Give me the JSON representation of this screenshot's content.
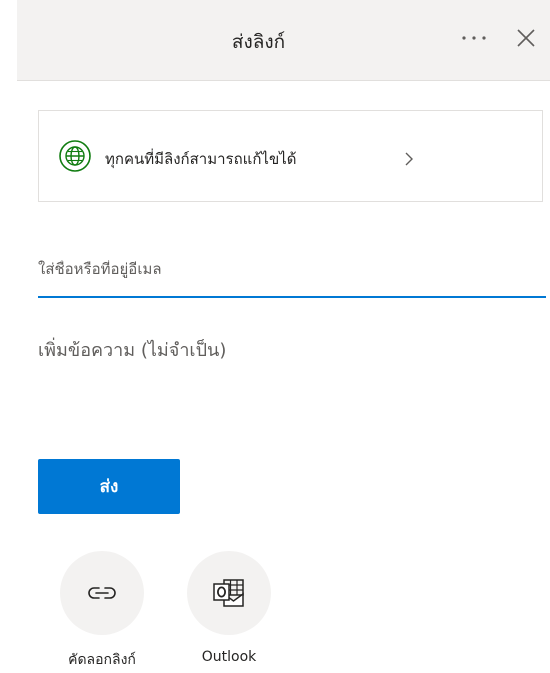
{
  "header": {
    "title": "ส่งลิงก์"
  },
  "link_settings": {
    "label": "ทุกคนที่มีลิงก์สามารถแก้ไขได้"
  },
  "to_field": {
    "placeholder": "ใส่ชื่อหรือที่อยู่อีเมล",
    "value": ""
  },
  "message_field": {
    "placeholder": "เพิ่มข้อความ (ไม่จำเป็น)",
    "value": ""
  },
  "send_button": {
    "label": "ส่ง"
  },
  "share_options": [
    {
      "label": "คัดลอกลิงก์",
      "icon": "link-icon"
    },
    {
      "label": "Outlook",
      "icon": "outlook-icon"
    }
  ],
  "colors": {
    "accent": "#0078d4",
    "header_bg": "#f3f2f1",
    "globe_green": "#107c10"
  }
}
